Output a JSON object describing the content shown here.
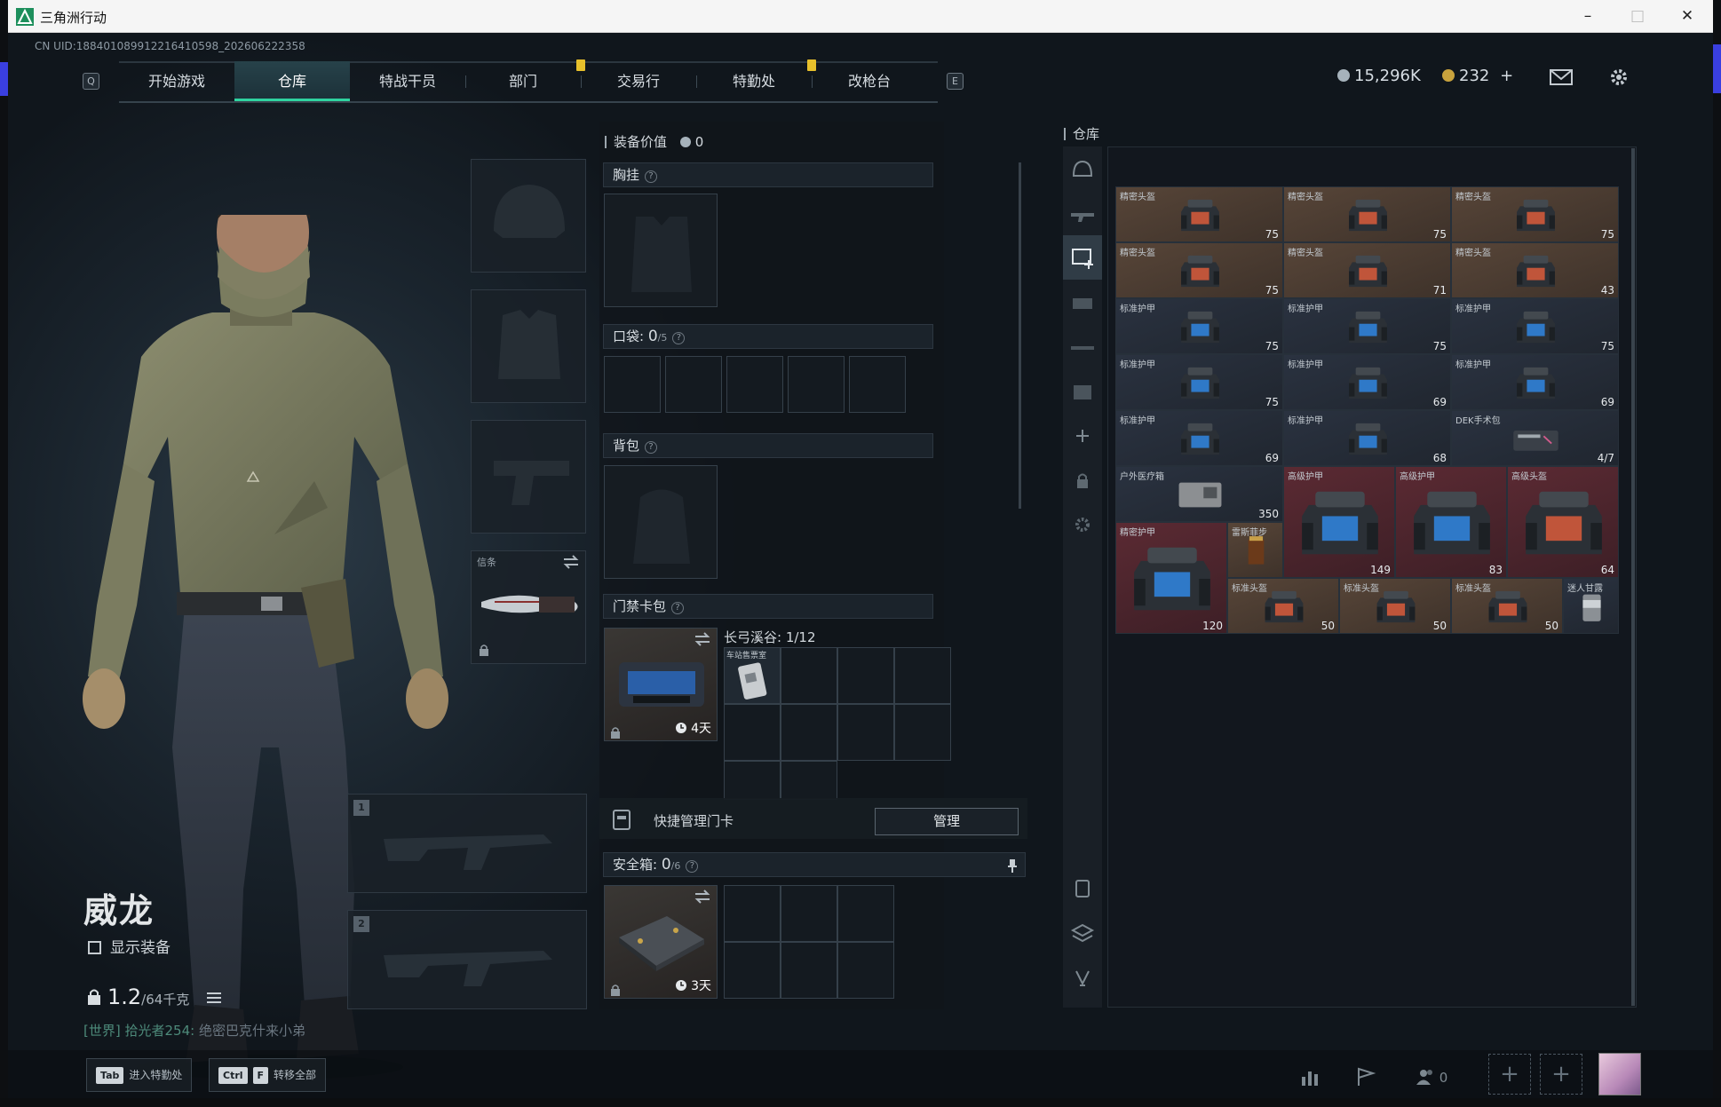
{
  "window": {
    "title": "三角洲行动"
  },
  "uid": "CN UID:1884010899122164105​98_202606222358",
  "nav": {
    "key_left": "Q",
    "key_right": "E",
    "tabs": [
      "开始游戏",
      "仓库",
      "特战干员",
      "部门",
      "交易行",
      "特勤处",
      "改枪台"
    ],
    "active": "仓库"
  },
  "currency": {
    "silver": "15,296K",
    "gold": "232",
    "gold_plus": "+"
  },
  "operator": {
    "name": "威龙",
    "show_equipment": "显示装备",
    "weight": "1.2",
    "weight_cap": "/64千克"
  },
  "chat": {
    "channel": "[世界]",
    "user": "拾光者254:",
    "message": "绝密巴克什来小弟"
  },
  "equipment": {
    "melee_label": "信条",
    "slot1": "1",
    "slot2": "2"
  },
  "loadout": {
    "value_label": "装备价值",
    "value": "0",
    "chest_rig": "胸挂",
    "pockets_label": "口袋:",
    "pockets_count": "0",
    "pockets_cap": "/5",
    "backpack": "背包",
    "keycard_label": "门禁卡包",
    "keycard_map": "长弓溪谷: 1/12",
    "keycard_item": "车站售票室",
    "keycard_days": "4天",
    "quick_manage": "快捷管理门卡",
    "manage_button": "管理",
    "safe_label": "安全箱:",
    "safe_count": "0",
    "safe_cap": "/6",
    "safe_days": "3天"
  },
  "warehouse": {
    "title": "仓库",
    "items": [
      {
        "name": "精密头盔",
        "dur": "75",
        "kind": "helmet"
      },
      {
        "name": "精密头盔",
        "dur": "75",
        "kind": "helmet"
      },
      {
        "name": "精密头盔",
        "dur": "75",
        "kind": "helmet"
      },
      {
        "name": "精密头盔",
        "dur": "75",
        "kind": "helmet"
      },
      {
        "name": "精密头盔",
        "dur": "71",
        "kind": "helmet"
      },
      {
        "name": "精密头盔",
        "dur": "43",
        "kind": "helmet"
      },
      {
        "name": "标准护甲",
        "dur": "75",
        "kind": "armor"
      },
      {
        "name": "标准护甲",
        "dur": "75",
        "kind": "armor"
      },
      {
        "name": "标准护甲",
        "dur": "75",
        "kind": "armor"
      },
      {
        "name": "标准护甲",
        "dur": "75",
        "kind": "armor"
      },
      {
        "name": "标准护甲",
        "dur": "69",
        "kind": "armor"
      },
      {
        "name": "标准护甲",
        "dur": "69",
        "kind": "armor"
      },
      {
        "name": "标准护甲",
        "dur": "69",
        "kind": "armor"
      },
      {
        "name": "标准护甲",
        "dur": "68",
        "kind": "armor"
      },
      {
        "name": "DEK手术包",
        "dur": "4/7",
        "kind": "medkit"
      },
      {
        "name": "户外医疗箱",
        "dur": "350",
        "kind": "firstaid"
      },
      {
        "name": "高级护甲",
        "dur": "149",
        "kind": "armor-big"
      },
      {
        "name": "高级护甲",
        "dur": "83",
        "kind": "armor-big"
      },
      {
        "name": "高级头盔",
        "dur": "64",
        "kind": "helmet-big"
      },
      {
        "name": "精密护甲",
        "dur": "120",
        "kind": "armor-big"
      },
      {
        "name": "雷斯菲步",
        "dur": "",
        "kind": "drink"
      },
      {
        "name": "标准头盔",
        "dur": "50",
        "kind": "helmet"
      },
      {
        "name": "标准头盔",
        "dur": "50",
        "kind": "helmet"
      },
      {
        "name": "标准头盔",
        "dur": "50",
        "kind": "helmet"
      },
      {
        "name": "迷人甘露",
        "dur": "",
        "kind": "can"
      }
    ]
  },
  "footer": {
    "tab_key": "Tab",
    "tab_hint": "进入特勤处",
    "ctrl_key": "Ctrl",
    "f_key": "F",
    "transfer_hint": "转移全部",
    "friends_count": "0"
  },
  "colors": {
    "accent": "#2fd3a0",
    "notify": "#e7c02b",
    "helmet_cell": "#4a3a30",
    "armor_cell": "#252d3a",
    "high_cell": "#5a2530"
  },
  "icons": [
    "app-logo-icon",
    "minimize-icon",
    "maximize-icon",
    "close-icon",
    "silver-coin-icon",
    "gold-coin-icon",
    "mail-icon",
    "settings-icon",
    "lock-icon",
    "swap-icon",
    "clock-icon",
    "help-icon",
    "pin-icon",
    "card-icon",
    "stats-icon",
    "flag-icon",
    "friends-icon",
    "helmet-icon",
    "armor-icon",
    "filter-icon"
  ]
}
